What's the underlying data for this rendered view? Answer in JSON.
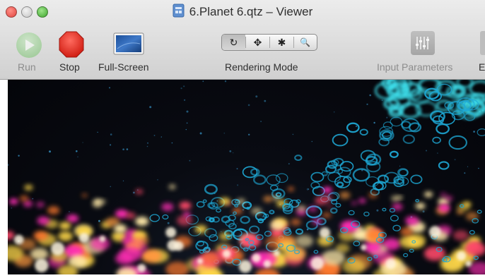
{
  "window": {
    "title": "6.Planet 6.qtz – Viewer",
    "doc_icon": "qtz-document-icon"
  },
  "toolbar": {
    "run_label": "Run",
    "run_enabled": false,
    "stop_label": "Stop",
    "fullscreen_label": "Full-Screen",
    "rendering_mode_label": "Rendering Mode",
    "rendering_modes": [
      {
        "icon": "rotate-icon",
        "glyph": "↻",
        "selected": true
      },
      {
        "icon": "move-icon",
        "glyph": "✥",
        "selected": false
      },
      {
        "icon": "bug-icon",
        "glyph": "✱",
        "selected": false
      },
      {
        "icon": "zoom-icon",
        "glyph": "🔍",
        "selected": false
      }
    ],
    "input_parameters_label": "Input Parameters",
    "input_parameters_enabled": false,
    "edit_label": "E"
  },
  "colors": {
    "accent_green": "#75bd6b",
    "stop_red": "#e02a1f",
    "viewer_background": "#07090f",
    "particle_cyan": "#1ea9d6",
    "particle_magenta": "#ff2fb4",
    "particle_yellow": "#ffd84a"
  }
}
